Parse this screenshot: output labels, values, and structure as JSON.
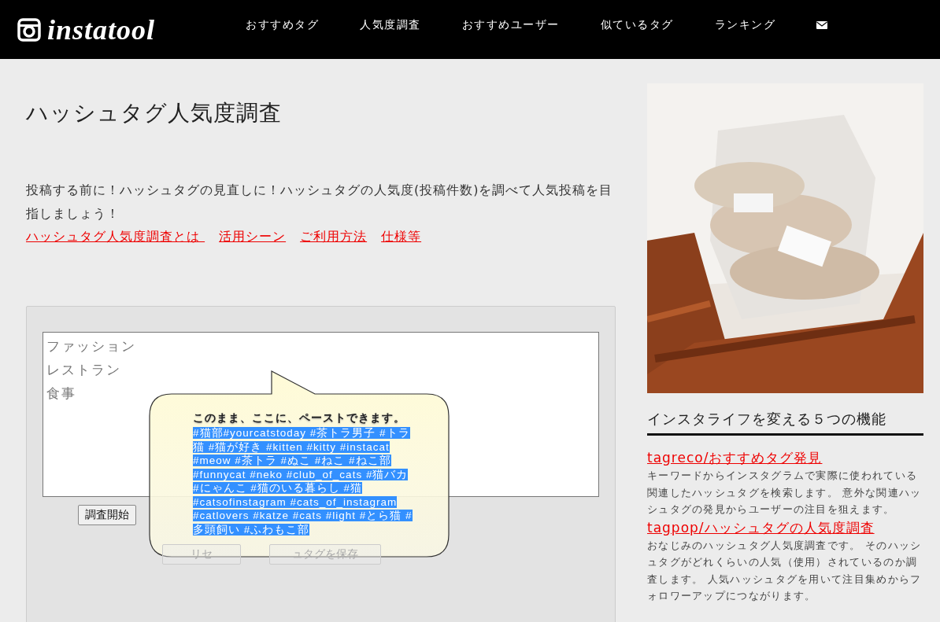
{
  "header": {
    "logo_text": "instatool",
    "nav": [
      {
        "label": "おすすめタグ"
      },
      {
        "label": "人気度調査"
      },
      {
        "label": "おすすめユーザー"
      },
      {
        "label": "似ているタグ"
      },
      {
        "label": "ランキング"
      }
    ]
  },
  "page": {
    "title": "ハッシュタグ人気度調査",
    "intro": "投稿する前に！ハッシュタグの見直しに！ハッシュタグの人気度(投稿件数)を調べて人気投稿を目指しましょう！",
    "links": [
      "ハッシュタグ人気度調査とは ",
      "活用シーン",
      "ご利用方法",
      "仕様等"
    ]
  },
  "form": {
    "placeholder": [
      "ファッション",
      "レストラン",
      "食事"
    ],
    "submit": "調査開始",
    "buttons": [
      {
        "label": "リセ",
        "disabled": true
      },
      {
        "label": "ュタグを保存",
        "disabled": true
      }
    ]
  },
  "tooltip": {
    "title": "このまま、ここに、ペーストできます。",
    "text": "#猫部#yourcatstoday #茶トラ男子 #トラ猫 #猫が好き #kitten #kitty #instacat #meow #茶トラ #ぬこ #ねこ #ねこ部 #funnycat #neko #club_of_cats #猫バカ #にゃんこ #猫のいる暮らし #猫 #catsofinstagram #cats_of_instagram #catlovers #katze #cats #light #とら猫 #多頭飼い #ふわもこ部",
    "selected": true
  },
  "sidebar": {
    "heading": "インスタライフを変える５つの機能",
    "features": [
      {
        "title": "tagreco/おすすめタグ発見",
        "description": "キーワードからインスタグラムで実際に使われている関連したハッシュタグを検索します。 意外な関連ハッシュタグの発見からユーザーの注目を狙えます。"
      },
      {
        "title": "tagpop/ハッシュタグの人気度調査",
        "description": "おなじみのハッシュタグ人気度調査です。 そのハッシュタグがどれくらいの人気（使用）されているのか調査します。 人気ハッシュタグを用いて注目集めからフォロワーアップにつながります。"
      }
    ]
  }
}
